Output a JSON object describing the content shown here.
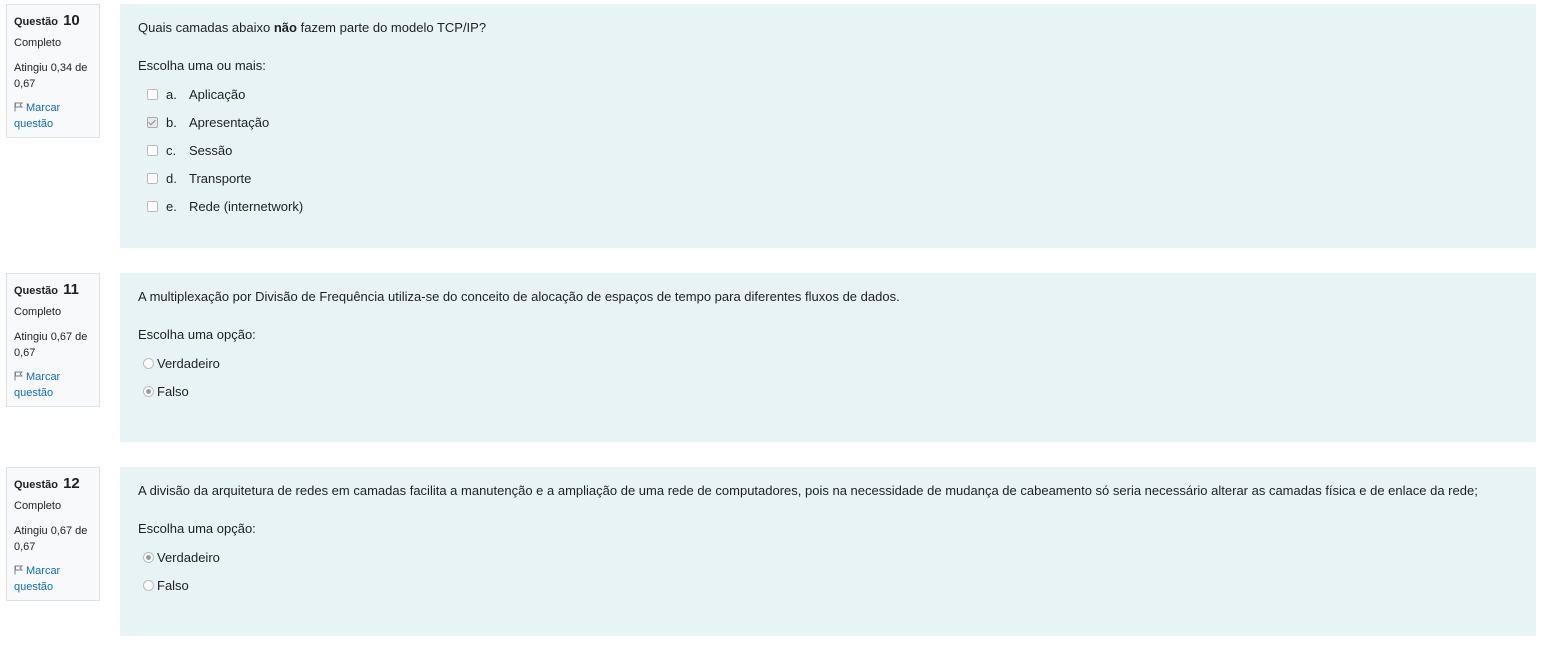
{
  "questions": [
    {
      "label": "Questão",
      "number": "10",
      "state": "Completo",
      "grade": "Atingiu 0,34 de 0,67",
      "flag_label": "Marcar questão",
      "text_before": "Quais camadas abaixo ",
      "text_bold": "não",
      "text_after": " fazem parte do modelo TCP/IP?",
      "prompt": "Escolha uma ou mais:",
      "options": [
        {
          "letter": "a.",
          "text": "Aplicação",
          "checked": false
        },
        {
          "letter": "b.",
          "text": "Apresentação",
          "checked": true
        },
        {
          "letter": "c.",
          "text": "Sessão",
          "checked": false
        },
        {
          "letter": "d.",
          "text": "Transporte",
          "checked": false
        },
        {
          "letter": "e.",
          "text": "Rede (internetwork)",
          "checked": false
        }
      ]
    },
    {
      "label": "Questão",
      "number": "11",
      "state": "Completo",
      "grade": "Atingiu 0,67 de 0,67",
      "flag_label": "Marcar questão",
      "text": "A multiplexação por Divisão de Frequência utiliza-se do conceito de alocação de espaços de tempo para diferentes fluxos de dados.",
      "prompt": "Escolha uma opção:",
      "options": [
        {
          "text": "Verdadeiro",
          "checked": false
        },
        {
          "text": "Falso",
          "checked": true
        }
      ]
    },
    {
      "label": "Questão",
      "number": "12",
      "state": "Completo",
      "grade": "Atingiu 0,67 de 0,67",
      "flag_label": "Marcar questão",
      "text": "A divisão da arquitetura de redes em camadas facilita a manutenção e a ampliação de uma rede de computadores, pois na necessidade de mudança de cabeamento só seria necessário alterar as camadas física e de enlace da rede;",
      "prompt": "Escolha uma opção:",
      "options": [
        {
          "text": "Verdadeiro",
          "checked": true
        },
        {
          "text": "Falso",
          "checked": false
        }
      ]
    }
  ],
  "colors": {
    "content_bg": "#e7f3f5",
    "info_bg": "#f8f9fa",
    "link": "#0f6cbf"
  },
  "icons": {
    "flag": "flag-icon"
  }
}
